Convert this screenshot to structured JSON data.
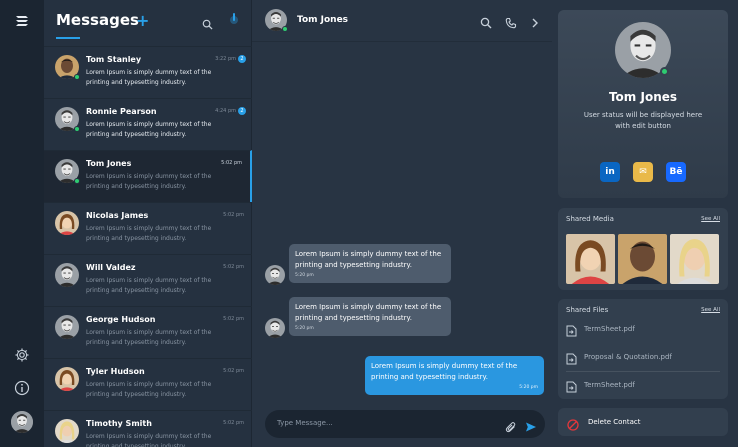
{
  "sidebar": {
    "logo_icon": "app-logo-icon",
    "items": [
      {
        "icon": "gear-icon"
      },
      {
        "icon": "info-icon"
      }
    ]
  },
  "messages_panel": {
    "title": "Messages",
    "add_label": "+",
    "conversations": [
      {
        "name": "Tom Stanley",
        "time": "3:22 pm",
        "badge": "2",
        "preview": "Lorem Ipsum is simply dummy text of the printing and typesetting industry.",
        "unread": true,
        "online": true
      },
      {
        "name": "Ronnie Pearson",
        "time": "4:24 pm",
        "badge": "2",
        "preview": "Lorem Ipsum is simply dummy text of the printing and typesetting industry.",
        "unread": true,
        "online": true
      },
      {
        "name": "Tom Jones",
        "time": "5:02 pm",
        "badge": "",
        "preview": "Lorem Ipsum is simply dummy text of the printing and typesetting industry.",
        "unread": false,
        "online": true,
        "active": true
      },
      {
        "name": "Nicolas James",
        "time": "5:02 pm",
        "badge": "",
        "preview": "Lorem Ipsum is simply dummy text of the printing and typesetting industry.",
        "unread": false,
        "online": false
      },
      {
        "name": "Will Valdez",
        "time": "5:02 pm",
        "badge": "",
        "preview": "Lorem Ipsum is simply dummy text of the printing and typesetting industry.",
        "unread": false,
        "online": false
      },
      {
        "name": "George Hudson",
        "time": "5:02 pm",
        "badge": "",
        "preview": "Lorem Ipsum is simply dummy text of the printing and typesetting industry.",
        "unread": false,
        "online": false
      },
      {
        "name": "Tyler Hudson",
        "time": "5:02 pm",
        "badge": "",
        "preview": "Lorem Ipsum is simply dummy text of the printing and typesetting industry.",
        "unread": false,
        "online": false
      },
      {
        "name": "Timothy Smith",
        "time": "5:02 pm",
        "badge": "",
        "preview": "Lorem Ipsum is simply dummy text of the printing and typesetting industry.",
        "unread": false,
        "online": false
      }
    ]
  },
  "chat": {
    "contact_name": "Tom Jones",
    "messages": [
      {
        "direction": "in",
        "text": "Lorem Ipsum is simply dummy text of the printing and typesetting industry.",
        "time": "5:20 pm"
      },
      {
        "direction": "in",
        "text": "Lorem Ipsum is simply dummy text of the printing and typesetting industry.",
        "time": "5:20 pm"
      },
      {
        "direction": "out",
        "text": "Lorem Ipsum is simply dummy text of the printing and typesetting industry.",
        "time": "5:20 pm"
      }
    ],
    "compose_placeholder": "Type Message..."
  },
  "profile": {
    "name": "Tom Jones",
    "status": "User status will be displayed here with edit button",
    "socials": [
      {
        "label": "in",
        "icon": "linkedin-icon",
        "color": "#0a66c2"
      },
      {
        "label": "✉",
        "icon": "mail-icon",
        "color": "#e9b949"
      },
      {
        "label": "Bē",
        "icon": "behance-icon",
        "color": "#1769ff"
      }
    ]
  },
  "shared_media": {
    "title": "Shared Media",
    "see_all": "See All"
  },
  "shared_files": {
    "title": "Shared Files",
    "see_all": "See All",
    "files": [
      "TermSheet.pdf",
      "Proposal & Quotation.pdf",
      "TermSheet.pdf"
    ]
  },
  "delete_contact": {
    "label": "Delete Contact"
  },
  "colors": {
    "accent": "#29a0e8",
    "online": "#2ecc71",
    "danger": "#e5373b"
  }
}
